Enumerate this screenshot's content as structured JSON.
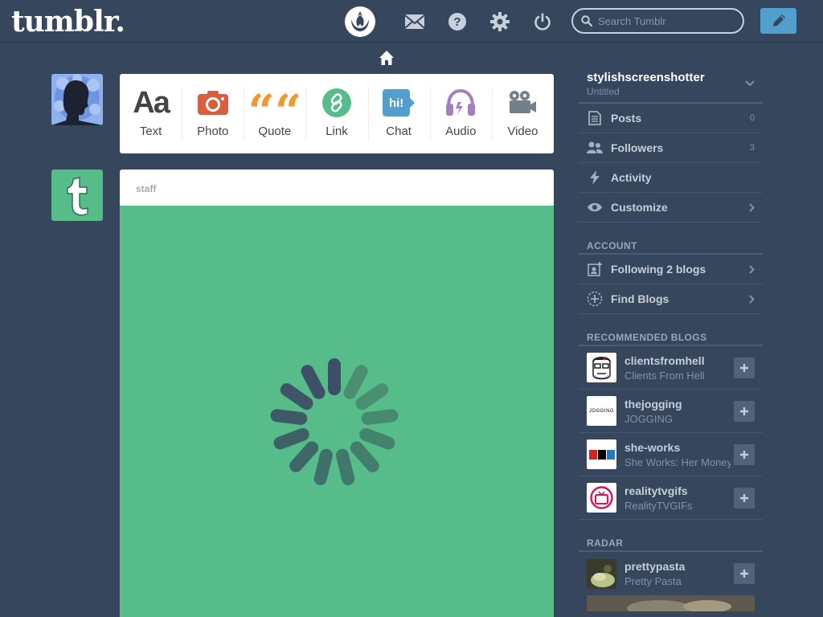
{
  "header": {
    "logo": "tumblr.",
    "search_placeholder": "Search Tumblr"
  },
  "post_types": [
    {
      "label": "Text",
      "glyph": "Aa",
      "color": "#444444"
    },
    {
      "label": "Photo",
      "color": "#d95e40"
    },
    {
      "label": "Quote",
      "glyph": "““",
      "color": "#f2992e"
    },
    {
      "label": "Link",
      "color": "#56bc8a"
    },
    {
      "label": "Chat",
      "glyph": "hi!",
      "color": "#529ecc"
    },
    {
      "label": "Audio",
      "color": "#a77dc2"
    },
    {
      "label": "Video",
      "color": "#748089"
    }
  ],
  "post": {
    "author": "staff"
  },
  "sidebar": {
    "blog_name": "stylishscreenshotter",
    "blog_title": "Untitled",
    "items": [
      {
        "label": "Posts",
        "count": "0"
      },
      {
        "label": "Followers",
        "count": "3"
      },
      {
        "label": "Activity"
      },
      {
        "label": "Customize"
      }
    ],
    "account_heading": "ACCOUNT",
    "account_items": [
      {
        "label": "Following 2 blogs"
      },
      {
        "label": "Find Blogs"
      }
    ],
    "recommended_heading": "RECOMMENDED BLOGS",
    "recommended": [
      {
        "name": "clientsfromhell",
        "title": "Clients From Hell"
      },
      {
        "name": "thejogging",
        "title": "JOGGING",
        "thumb_text": "JOGGING"
      },
      {
        "name": "she-works",
        "title": "She Works: Her Money",
        "thumb_text": "npr"
      },
      {
        "name": "realitytvgifs",
        "title": "RealityTVGIFs"
      }
    ],
    "radar_heading": "RADAR",
    "radar": [
      {
        "name": "prettypasta",
        "title": "Pretty Pasta"
      }
    ]
  },
  "colors": {
    "background": "#36465d",
    "accent": "#529ecc",
    "post_green": "#56bc8a",
    "staff_green": "#56bc8a"
  }
}
